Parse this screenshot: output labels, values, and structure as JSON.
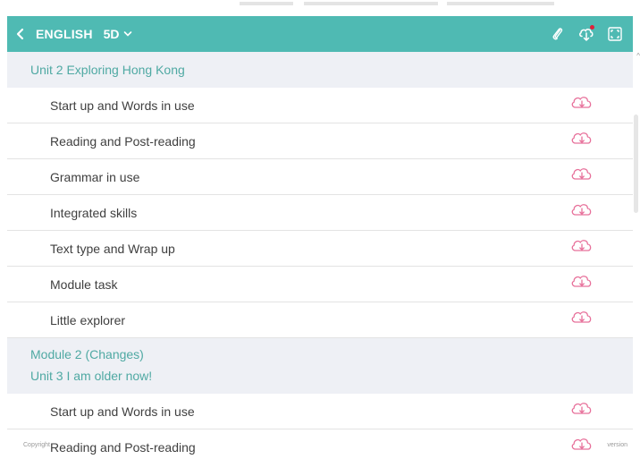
{
  "header": {
    "title": "ENGLISH",
    "grade": "5D",
    "icons": [
      "back-chevron-icon",
      "chevron-down-icon",
      "clip-icon",
      "cloud-download-icon",
      "fullscreen-icon"
    ]
  },
  "sections": [
    {
      "lines": [
        "Unit 2  Exploring Hong Kong"
      ],
      "items": [
        "Start up and Words in use",
        "Reading and Post-reading",
        "Grammar in use",
        "Integrated skills",
        "Text type and Wrap up",
        "Module task",
        "Little explorer"
      ]
    },
    {
      "lines": [
        "Module 2 (Changes)",
        "Unit 3  I am older now!"
      ],
      "items": [
        "Start up and Words in use",
        "Reading and Post-reading"
      ]
    }
  ],
  "footer": {
    "copyright": "Copyright",
    "version": "version"
  },
  "colors": {
    "header_bg": "#4fbab3",
    "section_bg": "#eef0f5",
    "section_text": "#4fa9a3",
    "download_icon": "#e7709a"
  }
}
